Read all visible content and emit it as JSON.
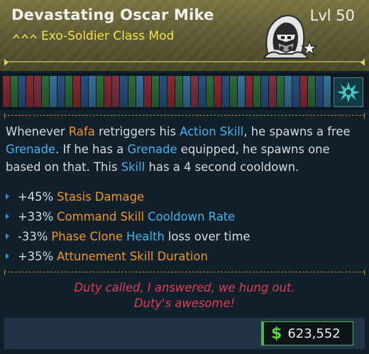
{
  "item": {
    "name": "Devastating Oscar Mike",
    "type": "Exo-Soldier Class Mod",
    "level": "Lvl 50",
    "rarity_color": "#f0e34a",
    "emblem_icon": "hooded-soldier-class-icon"
  },
  "manufacturer_strip": {
    "stripe_colors": [
      "#8a2a33",
      "#2f6b3a",
      "#2a4f7e",
      "#8a2a33",
      "#7d3344",
      "#2f6b3a",
      "#35719a",
      "#2a4f7e",
      "#2f6b3a",
      "#8a2a33",
      "#2a4f7e",
      "#35719a",
      "#2f6b3a",
      "#8a2a33",
      "#7d3344",
      "#2a4f7e",
      "#2f6b3a",
      "#35719a",
      "#8a2a33",
      "#2f6b3a",
      "#2a4f7e",
      "#8a2a33",
      "#2f6b3a",
      "#35719a",
      "#7d3344",
      "#2a4f7e",
      "#2f6b3a",
      "#8a2a33",
      "#2a4f7e",
      "#2f6b3a",
      "#35719a",
      "#8a2a33",
      "#2f6b3a",
      "#2a4f7e",
      "#7d3344",
      "#2f6b3a",
      "#35719a",
      "#2a4f7e",
      "#8a2a33",
      "#2f6b3a",
      "#2a4f7e",
      "#35719a"
    ],
    "icon": "crystal-splash-icon"
  },
  "description": {
    "segments": [
      {
        "text": "Whenever ",
        "color": "plain"
      },
      {
        "text": "Rafa",
        "color": "orange"
      },
      {
        "text": " retriggers his ",
        "color": "plain"
      },
      {
        "text": "Action Skill",
        "color": "blue"
      },
      {
        "text": ", he spawns a free ",
        "color": "plain"
      },
      {
        "text": "Grenade",
        "color": "blue"
      },
      {
        "text": ". If he has a ",
        "color": "plain"
      },
      {
        "text": "Grenade",
        "color": "blue"
      },
      {
        "text": " equipped, he spawns one based on that. This ",
        "color": "plain"
      },
      {
        "text": "Skill",
        "color": "blue"
      },
      {
        "text": " has a 4 second cooldown.",
        "color": "plain"
      }
    ]
  },
  "bonuses": [
    {
      "value": "+45%",
      "parts": [
        {
          "text": "Stasis Damage",
          "color": "orange"
        }
      ]
    },
    {
      "value": "+33%",
      "parts": [
        {
          "text": "Command Skill",
          "color": "orange"
        },
        {
          "text": "Cooldown Rate",
          "color": "blue"
        }
      ]
    },
    {
      "value": "-33%",
      "parts": [
        {
          "text": "Phase Clone",
          "color": "orange"
        },
        {
          "text": "Health",
          "color": "blue"
        },
        {
          "text": "loss over time",
          "color": "plain"
        }
      ]
    },
    {
      "value": "+35%",
      "parts": [
        {
          "text": "Attunement Skill Duration",
          "color": "orange"
        }
      ]
    }
  ],
  "flavor_text": [
    "Duty called, I answered, we hung out.",
    "Duty's awesome!"
  ],
  "price": {
    "currency_symbol": "$",
    "value": "623,552"
  },
  "colors": {
    "orange": "#f0962e",
    "blue": "#46b2ec",
    "flavor": "#e23d52",
    "price_green": "#5fd04a"
  }
}
